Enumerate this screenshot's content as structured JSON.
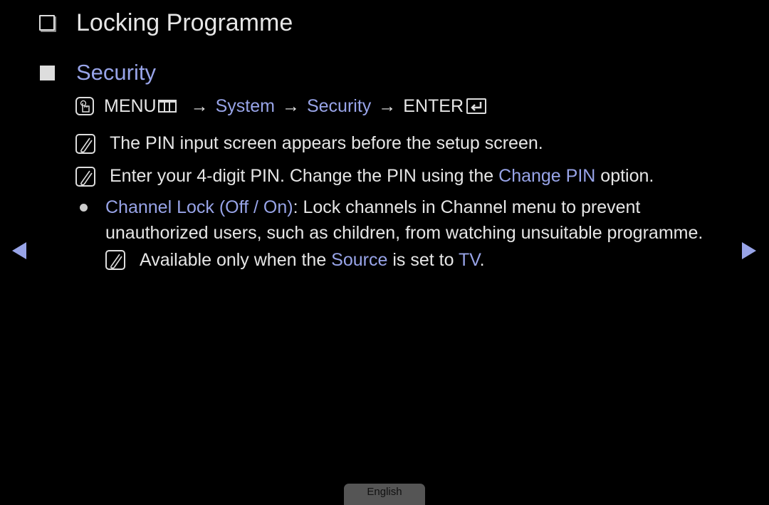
{
  "header": {
    "title": "Locking Programme",
    "title_icon": "checkbox-outline-icon"
  },
  "section": {
    "title": "Security",
    "section_icon": "filled-square-icon"
  },
  "menu_path": {
    "icon": "remote-press-icon",
    "steps": [
      "MENU",
      "System",
      "Security",
      "ENTER"
    ],
    "separator": "→"
  },
  "notes": [
    {
      "icon": "note-icon",
      "text": "The PIN input screen appears before the setup screen."
    },
    {
      "icon": "note-icon",
      "parts": [
        "Enter your 4-digit PIN. Change the PIN using the ",
        "Change PIN",
        " option."
      ]
    }
  ],
  "bullet": {
    "label": "Channel Lock (Off / On)",
    "text_line1": ": Lock channels in Channel menu to prevent",
    "text_line2": "unauthorized users, such as children, from watching unsuitable programme.",
    "note": {
      "icon": "note-icon",
      "parts": [
        "Available only when the ",
        "Source",
        " is set to ",
        "TV",
        "."
      ]
    }
  },
  "navigation": {
    "prev": "previous-page",
    "next": "next-page"
  },
  "language": {
    "label": "English"
  },
  "colors": {
    "highlight": "#98a4e8",
    "text": "#e6e6e6",
    "background": "#000000"
  }
}
